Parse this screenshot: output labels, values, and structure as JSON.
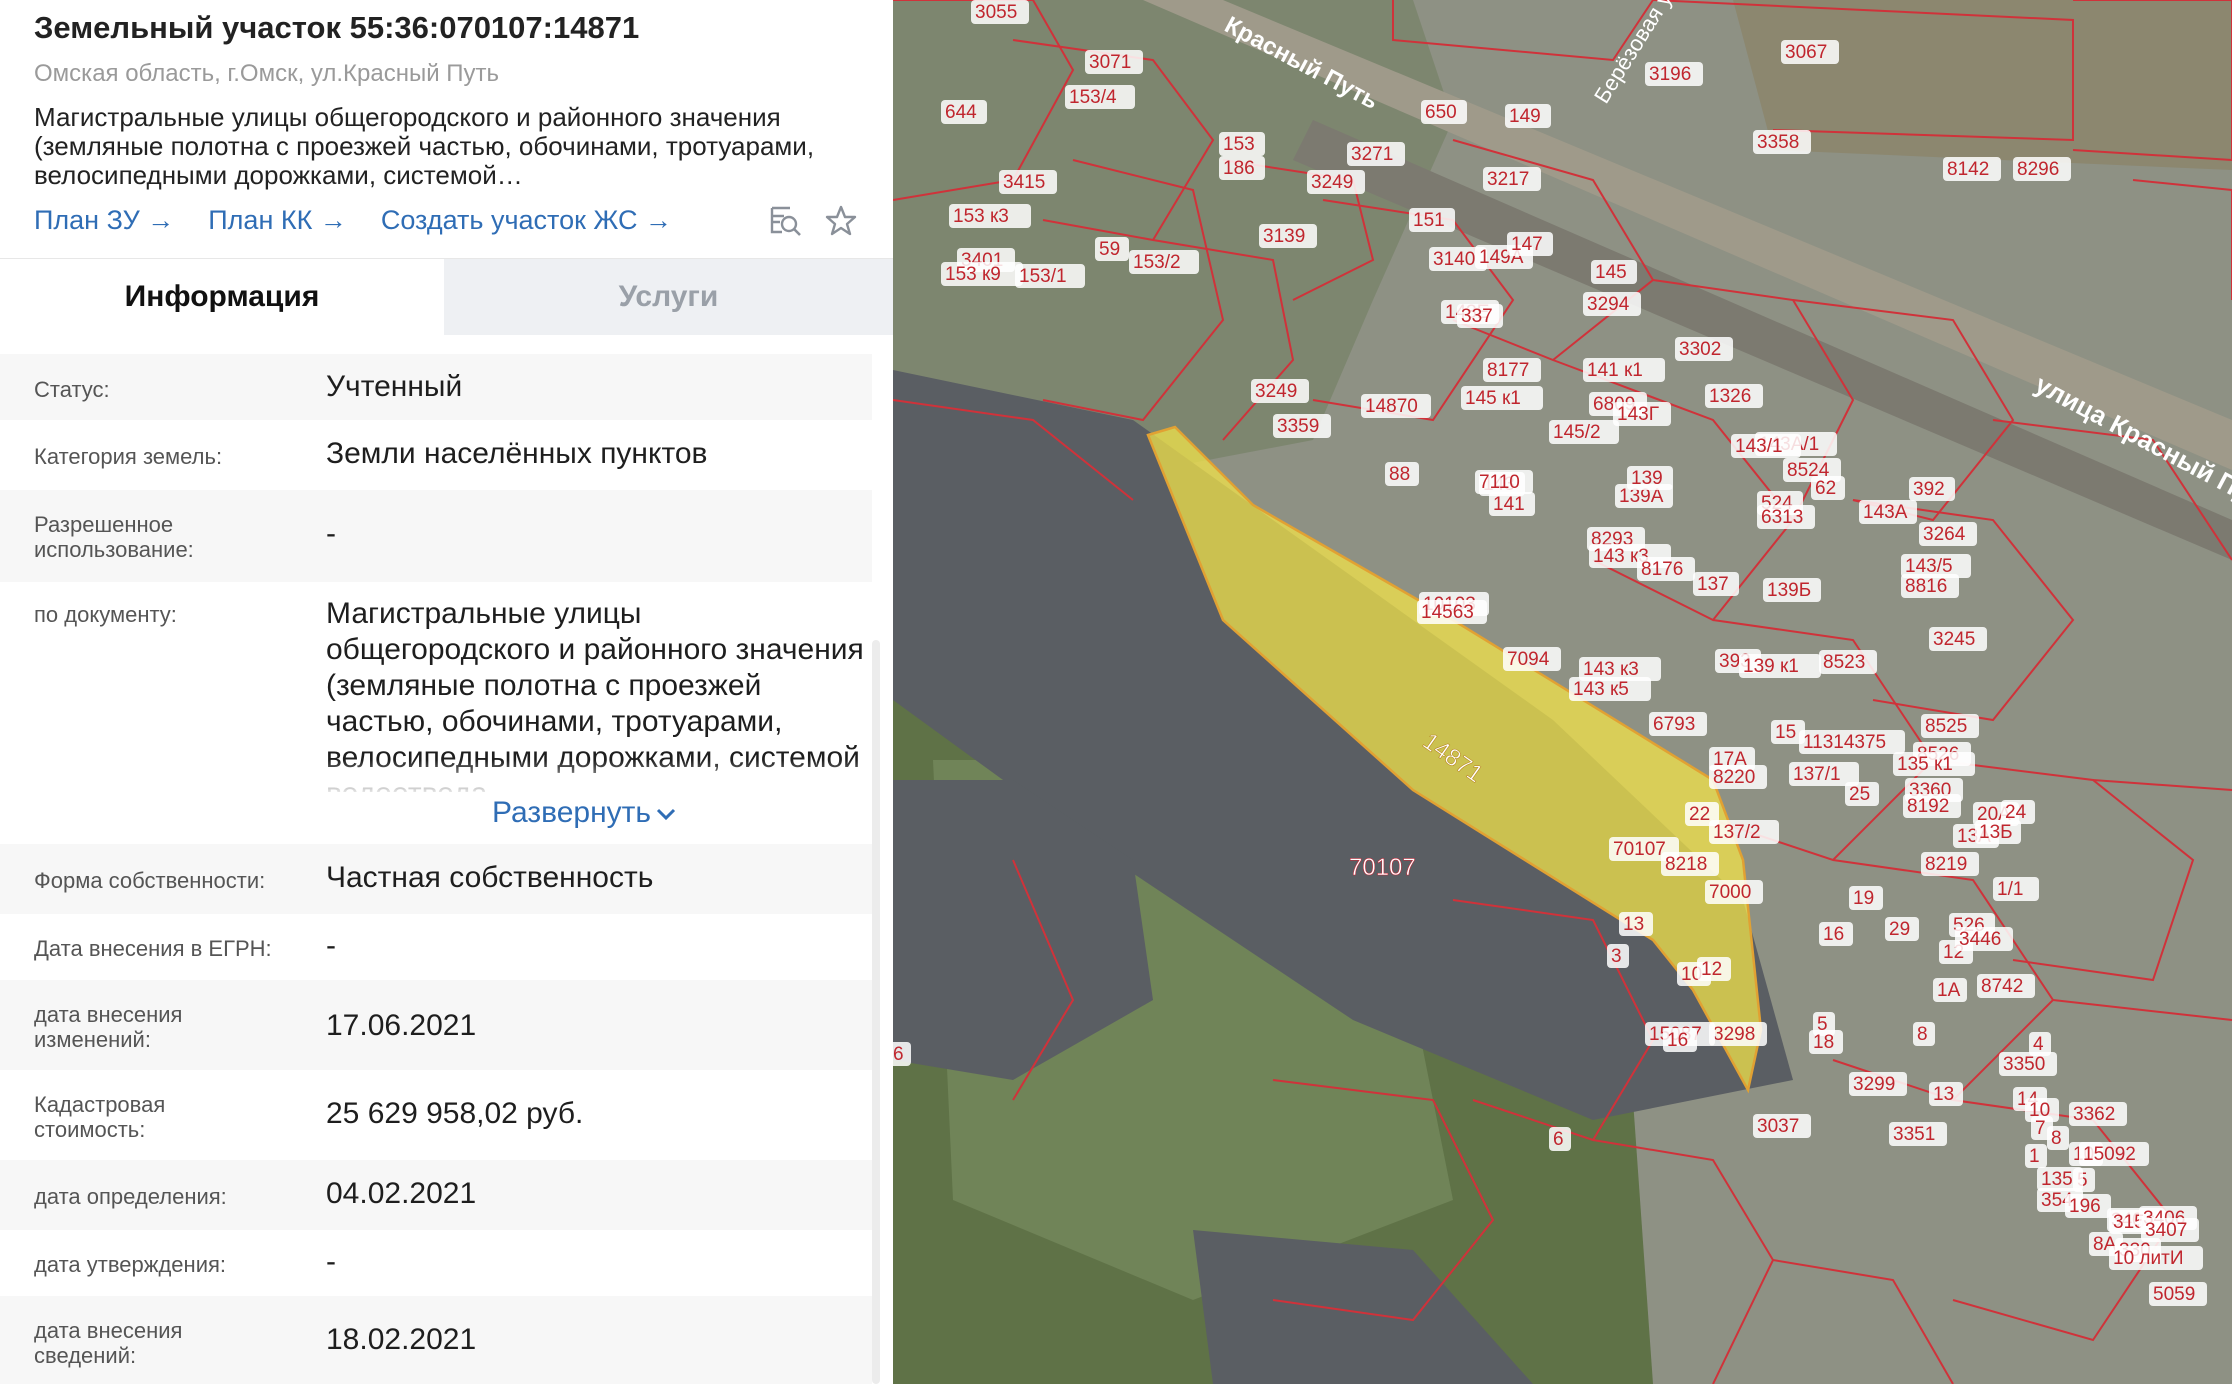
{
  "panel": {
    "title": "Земельный участок 55:36:070107:14871",
    "address": "Омская область, г.Омск, ул.Красный Путь",
    "description": "Магистральные улицы общегородского и районного значения (земляные полотна с проезжей частью, обочинами, тротуарами, велосипедными дорожками, системой…",
    "links": {
      "plan_zu": "План ЗУ",
      "plan_kk": "План КК",
      "create_zs": "Создать участок ЖС"
    },
    "tabs": {
      "info": "Информация",
      "services": "Услуги"
    },
    "fields": {
      "status_label": "Статус:",
      "status_value": "Учтенный",
      "category_label": "Категория земель:",
      "category_value": "Земли населённых пунктов",
      "permitted_label": "Разрешенное использование:",
      "permitted_value": "-",
      "by_doc_label": "по документу:",
      "by_doc_value": "Магистральные улицы общегородского и районного значения (земляные полотна с проезжей частью, обочинами, тротуарами, велосипедными дорожками, системой водоотвода",
      "expand_label": "Развернуть",
      "ownership_label": "Форма собственности:",
      "ownership_value": "Частная собственность",
      "egrn_date_label": "Дата внесения в ЕГРН:",
      "egrn_date_value": "-",
      "changes_date_label": "дата внесения изменений:",
      "changes_date_value": "17.06.2021",
      "cadastral_cost_label": "Кадастровая стоимость:",
      "cadastral_cost_value": "25 629 958,02 руб.",
      "determination_date_label": "дата определения:",
      "determination_date_value": "04.02.2021",
      "approval_date_label": "дата утверждения:",
      "approval_date_value": "-",
      "info_date_label": "дата внесения сведений:",
      "info_date_value": "18.02.2021"
    }
  },
  "icons": {
    "arrow": "arrow-right-icon",
    "search_doc": "search-document-icon",
    "favorite": "star-icon",
    "chevron": "chevron-down-icon"
  },
  "colors": {
    "link": "#2f6db5",
    "parcel_border": "#d0323a",
    "highlight": "#f1e34a"
  },
  "map": {
    "street_labels": [
      "Красный Путь",
      "Берёзовая ул.",
      "улица Красный Пу"
    ],
    "quarter_label": "70107",
    "highlight_label": "14871",
    "labels": [
      "3055",
      "3071",
      "3067",
      "3196",
      "650",
      "3358",
      "8142",
      "8296",
      "644",
      "153/4",
      "3415",
      "153",
      "186",
      "3249",
      "153 к3",
      "3271",
      "3401",
      "153 к9",
      "59",
      "153/1",
      "153/2",
      "3139",
      "149",
      "3217",
      "151",
      "3140",
      "149А",
      "147",
      "145",
      "3294",
      "143Е",
      "337",
      "3302",
      "141 к1",
      "1326",
      "3249",
      "3359",
      "14870",
      "8177",
      "145 к1",
      "6809",
      "145/2",
      "143Г",
      "143",
      "88",
      "7110",
      "139А",
      "143А/1",
      "143/1",
      "8524",
      "62",
      "141",
      "8293",
      "139",
      "524",
      "6313",
      "143А",
      "392",
      "143 к3",
      "8816",
      "139Б",
      "137",
      "3264",
      "143/5",
      "10103",
      "14563",
      "8176",
      "143 к3",
      "393",
      "139 к1",
      "3245",
      "15",
      "8523",
      "7094",
      "143 к5",
      "6793",
      "17А",
      "8525",
      "8526",
      "135 к1",
      "11314375",
      "8220",
      "137/1",
      "3360",
      "20А",
      "24",
      "25",
      "8192",
      "13А",
      "13Б",
      "22",
      "137/2",
      "70107",
      "8218",
      "7000",
      "13",
      "16",
      "19",
      "8219",
      "1/1",
      "526",
      "12",
      "29",
      "3446",
      "8742",
      "3",
      "10",
      "12",
      "1А",
      "3298",
      "8",
      "5",
      "15087",
      "16",
      "18",
      "3350",
      "4",
      "6",
      "14",
      "10",
      "3362",
      "3299",
      "13",
      "3037",
      "7",
      "8",
      "10",
      "1",
      "15092",
      "5",
      "6",
      "3351",
      "354",
      "3405",
      "135",
      "196",
      "3156",
      "3406",
      "3407",
      "8А",
      "330",
      "10 литИ",
      "5059"
    ]
  }
}
